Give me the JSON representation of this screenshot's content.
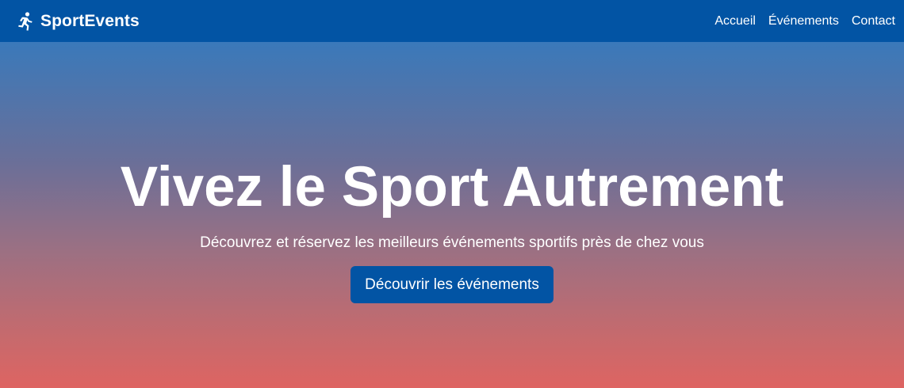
{
  "navbar": {
    "brand_icon": "running-person-icon",
    "brand_name": "SportEvents",
    "links": [
      {
        "label": "Accueil"
      },
      {
        "label": "Événements"
      },
      {
        "label": "Contact"
      }
    ]
  },
  "hero": {
    "title": "Vivez le Sport Autrement",
    "subtitle": "Découvrez et réservez les meilleurs événements sportifs près de chez vous",
    "cta_label": "Découvrir les événements"
  },
  "colors": {
    "navbar_background": "#0254a4",
    "button_background": "#0254a4",
    "gradient_top": "#3a79ba",
    "gradient_bottom": "#de6462",
    "text": "#ffffff"
  }
}
